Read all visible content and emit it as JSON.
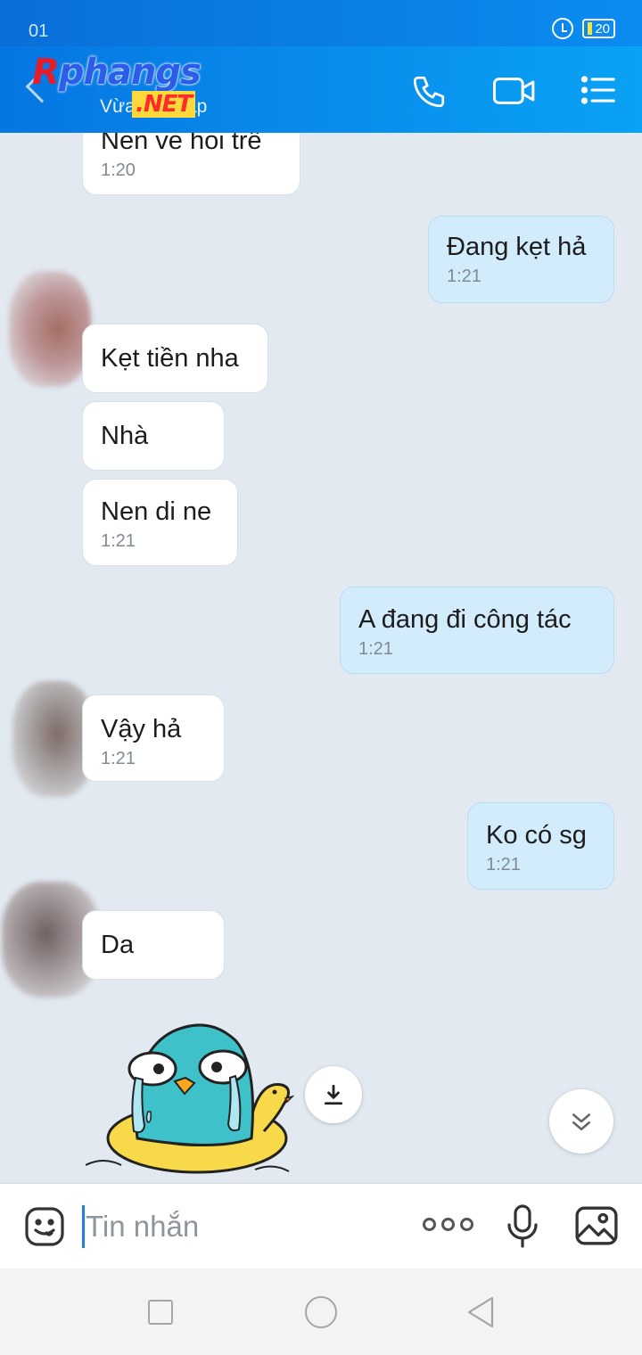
{
  "status_bar": {
    "time": "01",
    "battery": "20"
  },
  "header": {
    "logo_r": "R",
    "logo_rest": "phangs",
    "logo_net": ".NET",
    "status": "Vừa truy cập"
  },
  "messages": [
    {
      "dir": "in",
      "text": "Nen ve hoi trê",
      "time": "1:20"
    },
    {
      "dir": "out",
      "text": "Đang kẹt hả",
      "time": "1:21"
    },
    {
      "dir": "in",
      "text": "Kẹt tiền nha",
      "time": ""
    },
    {
      "dir": "in",
      "text": "Nhà",
      "time": ""
    },
    {
      "dir": "in",
      "text": "Nen di ne",
      "time": "1:21"
    },
    {
      "dir": "out",
      "text": "A đang đi công tác",
      "time": "1:21"
    },
    {
      "dir": "in",
      "text": "Vậy hả",
      "time": "1:21"
    },
    {
      "dir": "out",
      "text": "Ko có sg",
      "time": "1:21"
    },
    {
      "dir": "in",
      "text": "Da",
      "time": ""
    }
  ],
  "input": {
    "placeholder": "Tin nhắn"
  },
  "colors": {
    "header": "#0a8cf0",
    "chat_bg": "#e2e9f1",
    "out_bubble": "#d3ecfc",
    "in_bubble": "#ffffff"
  },
  "icons": [
    "back-icon",
    "phone-icon",
    "video-call-icon",
    "menu-icon",
    "download-icon",
    "scroll-down-icon",
    "emoji-icon",
    "more-icon",
    "mic-icon",
    "image-icon"
  ]
}
